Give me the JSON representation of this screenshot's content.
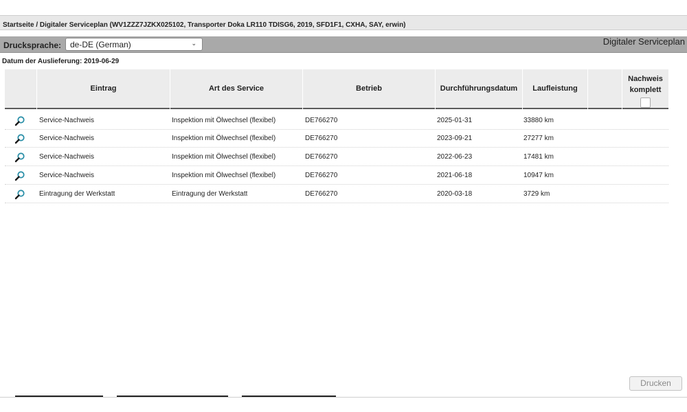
{
  "breadcrumb": "Startseite / Digitaler Serviceplan (WV1ZZZ7JZKX025102, Transporter Doka LR110 TDISG6, 2019, SFD1F1, CXHA, SAY, erwin)",
  "toolbar": {
    "language_label": "Druckspr ache:",
    "language_value": "de-DE (German)",
    "plan_title": "Digitaler Serviceplan"
  },
  "delivery_date": "Datum der Auslieferung: 2019-06-29",
  "table": {
    "columns": [
      "",
      "Eintrag",
      "Art des Service",
      "Betrieb",
      "Durchführungsdatum",
      "Laufleistung",
      ""
    ],
    "last_column_line1": "Nachweis",
    "last_column_line2": "komplett",
    "rows": [
      {
        "eintrag": "Service-Nachweis",
        "art": "Inspektion mit Ölwechsel (flexibel)",
        "betrieb": "DE766270",
        "datum": "2025-01-31",
        "laufleistung": "33880 km"
      },
      {
        "eintrag": "Service-Nachweis",
        "art": "Inspektion mit Ölwechsel (flexibel)",
        "betrieb": "DE766270",
        "datum": "2023-09-21",
        "laufleistung": "27277 km"
      },
      {
        "eintrag": "Service-Nachweis",
        "art": "Inspektion mit Ölwechsel (flexibel)",
        "betrieb": "DE766270",
        "datum": "2022-06-23",
        "laufleistung": "17481 km"
      },
      {
        "eintrag": "Service-Nachweis",
        "art": "Inspektion mit Ölwechsel (flexibel)",
        "betrieb": "DE766270",
        "datum": "2021-06-18",
        "laufleistung": "10947 km"
      },
      {
        "eintrag": "Eintragung der Werkstatt",
        "art": "Eintragung der Werkstatt",
        "betrieb": "DE766270",
        "datum": "2020-03-18",
        "laufleistung": "3729 km"
      }
    ]
  },
  "print_button": "Drucken",
  "icons": {
    "row_icon": "magnifier-icon",
    "dropdown": "chevron-down-icon"
  },
  "colors": {
    "toolbar": "#a9a9a9",
    "header": "#ececec",
    "magnifier_lens": "#2a8fa8"
  }
}
